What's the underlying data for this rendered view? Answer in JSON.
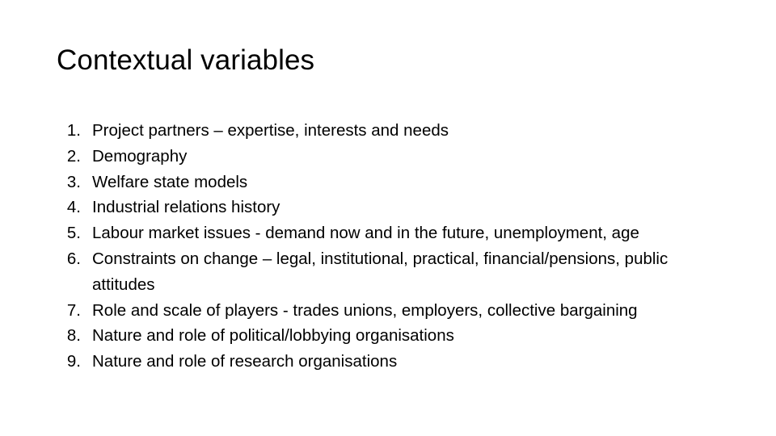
{
  "slide": {
    "title": "Contextual variables",
    "background_color": "#ffffff",
    "text_color": "#000000",
    "list": [
      {
        "number": "1.",
        "text": "Project partners – expertise, interests and needs"
      },
      {
        "number": "2.",
        "text": "Demography"
      },
      {
        "number": "3.",
        "text": "Welfare state models"
      },
      {
        "number": "4.",
        "text": "Industrial relations history"
      },
      {
        "number": "5.",
        "text": "Labour market issues - demand now and in the future, unemployment, age"
      },
      {
        "number": "6.",
        "text": "Constraints on change – legal, institutional, practical, financial/pensions, public attitudes"
      },
      {
        "number": "7.",
        "text": "Role and scale of players - trades unions, employers, collective bargaining"
      },
      {
        "number": "8.",
        "text": "Nature and role of political/lobbying organisations"
      },
      {
        "number": "9.",
        "text": "Nature and role of research organisations"
      }
    ]
  }
}
